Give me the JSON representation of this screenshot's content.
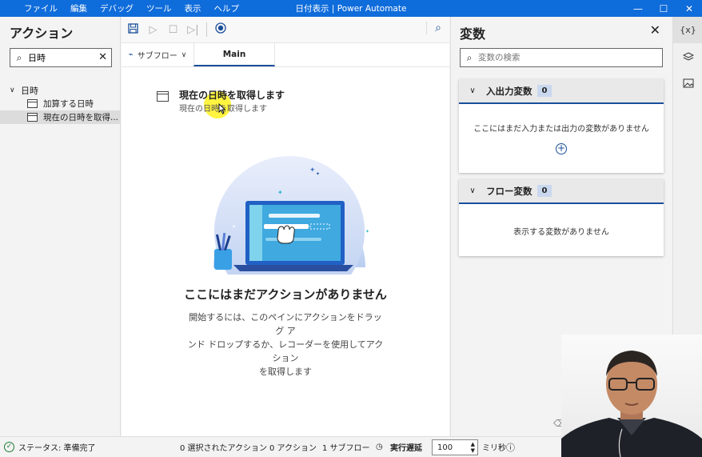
{
  "titlebar": {
    "menu": [
      "ファイル",
      "編集",
      "デバッグ",
      "ツール",
      "表示",
      "ヘルプ"
    ],
    "title": "日付表示 | Power Automate",
    "minimize": "—",
    "maximize": "☐",
    "close": "✕"
  },
  "actions_pane": {
    "title": "アクション",
    "search_value": "日時",
    "group": "日時",
    "items": [
      "加算する日時",
      "現在の日時を取得..."
    ],
    "selected_index": 1
  },
  "toolbar": {
    "subflow_label": "サブフロー",
    "main_tab": "Main"
  },
  "drag_ghost": {
    "title": "現在の日時を取得します",
    "subtitle": "現在の日時を取得します"
  },
  "empty_state": {
    "title": "ここにはまだアクションがありません",
    "desc_1": "開始するには、このペインにアクションをドラッグ ア",
    "desc_2": "ンド ドロップするか、レコーダーを使用してアクション",
    "desc_3": "を取得します"
  },
  "variables_pane": {
    "title": "変数",
    "search_placeholder": "変数の検索",
    "io_section": {
      "label": "入出力変数",
      "count": "0",
      "empty_text": "ここにはまだ入力または出力の変数がありません"
    },
    "flow_section": {
      "label": "フロー変数",
      "count": "0",
      "empty_text": "表示する変数がありません"
    }
  },
  "rail": {
    "vars_label": "{x}"
  },
  "statusbar": {
    "status": "ステータス: 準備完了",
    "selected": "0 選択されたアクション",
    "actions": "0 アクション",
    "subflows": "1 サブフロー",
    "delay_label": "実行遅延",
    "delay_value": "100",
    "unit": "ミリ秒"
  },
  "colors": {
    "titlebar": "#0f6cdb",
    "accent": "#1a4f9c",
    "highlight": "#fff000"
  }
}
